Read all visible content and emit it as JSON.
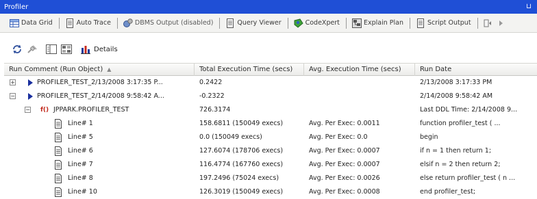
{
  "window": {
    "title": "Profiler",
    "pin_glyph": "⊔"
  },
  "tabs": [
    {
      "label": "Data Grid",
      "icon": "grid-icon"
    },
    {
      "label": "Auto Trace",
      "icon": "document-icon"
    },
    {
      "label": "DBMS Output (disabled)",
      "icon": "dbms-output-icon"
    },
    {
      "label": "Query Viewer",
      "icon": "document-icon"
    },
    {
      "label": "CodeXpert",
      "icon": "codexpert-icon"
    },
    {
      "label": "Explain Plan",
      "icon": "explain-plan-icon"
    },
    {
      "label": "Script Output",
      "icon": "document-icon"
    }
  ],
  "toolbar": {
    "details_label": "Details"
  },
  "columns": [
    {
      "label": "Run Comment (Run Object)",
      "sort": "▲"
    },
    {
      "label": "Total Execution Time (secs)"
    },
    {
      "label": "Avg. Execution Time (secs)"
    },
    {
      "label": "Run Date"
    }
  ],
  "rows": [
    {
      "level": 0,
      "expander": "+",
      "icon": "run-arrow-icon",
      "name": "PROFILER_TEST_2/13/2008 3:17:35 P...",
      "total": "0.2422",
      "avg": "",
      "date": "2/13/2008 3:17:33 PM"
    },
    {
      "level": 0,
      "expander": "−",
      "icon": "run-arrow-icon",
      "name": "PROFILER_TEST_2/14/2008 9:58:42 A...",
      "total": "-0.2322",
      "avg": "",
      "date": "2/14/2008 9:58:42 AM"
    },
    {
      "level": 1,
      "expander": "−",
      "icon": "function-icon",
      "icon_text": "f()",
      "name": "JPPARK.PROFILER_TEST",
      "total": "726.3174",
      "avg": "",
      "date": "Last DDL Time: 2/14/2008 9..."
    },
    {
      "level": 2,
      "expander": "",
      "icon": "line-icon",
      "name": "Line# 1",
      "total": "158.6811 (150049 execs)",
      "avg": "Avg. Per Exec: 0.0011",
      "date": "function      profiler_test ( ..."
    },
    {
      "level": 2,
      "expander": "",
      "icon": "line-icon",
      "name": "Line# 5",
      "total": "0.0 (150049 execs)",
      "avg": "Avg. Per Exec: 0.0",
      "date": "begin"
    },
    {
      "level": 2,
      "expander": "",
      "icon": "line-icon",
      "name": "Line# 6",
      "total": "127.6074 (178706 execs)",
      "avg": "Avg. Per Exec: 0.0007",
      "date": "if n = 1 then return 1;"
    },
    {
      "level": 2,
      "expander": "",
      "icon": "line-icon",
      "name": "Line# 7",
      "total": "116.4774 (167760 execs)",
      "avg": "Avg. Per Exec: 0.0007",
      "date": "elsif n = 2 then return 2;"
    },
    {
      "level": 2,
      "expander": "",
      "icon": "line-icon",
      "name": "Line# 8",
      "total": "197.2496 (75024 execs)",
      "avg": "Avg. Per Exec: 0.0026",
      "date": "else return profiler_test ( n ..."
    },
    {
      "level": 2,
      "expander": "",
      "icon": "line-icon",
      "name": "Line# 10",
      "total": "126.3019 (150049 execs)",
      "avg": "Avg. Per Exec: 0.0008",
      "date": "end profiler_test;"
    }
  ],
  "colors": {
    "titlebar": "#1f4fd6",
    "run_arrow": "#1a2f9e",
    "function_icon": "#c2281b"
  }
}
